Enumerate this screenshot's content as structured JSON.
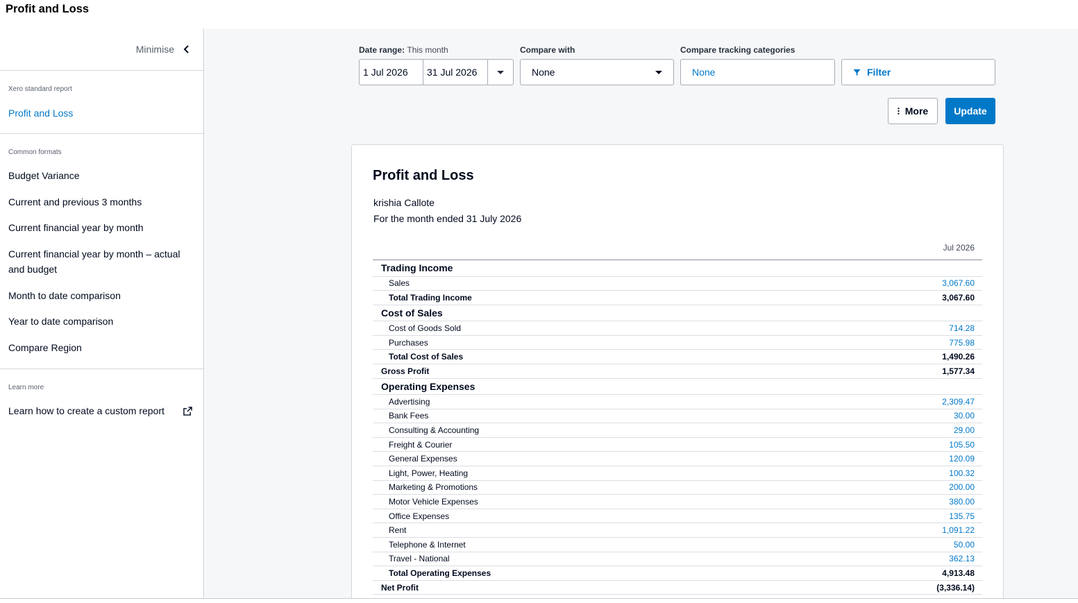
{
  "page_title": "Profit and Loss",
  "sidebar": {
    "minimise_label": "Minimise",
    "standard_heading": "Xero standard report",
    "standard_link": "Profit and Loss",
    "common_heading": "Common formats",
    "formats": [
      "Budget Variance",
      "Current and previous 3 months",
      "Current financial year by month",
      "Current financial year by month – actual and budget",
      "Month to date comparison",
      "Year to date comparison",
      "Compare Region"
    ],
    "learn_heading": "Learn more",
    "learn_link": "Learn how to create a custom report"
  },
  "controls": {
    "date_range_label": "Date range:",
    "date_range_value": "This month",
    "date_from": "1 Jul 2026",
    "date_to": "31 Jul 2026",
    "compare_with_label": "Compare with",
    "compare_with_value": "None",
    "tracking_label": "Compare tracking categories",
    "tracking_value": "None",
    "filter_label": "Filter",
    "more_label": "More",
    "update_label": "Update"
  },
  "report": {
    "title": "Profit and Loss",
    "organisation": "krishia Callote",
    "period": "For the month ended 31 July 2026",
    "column_header": "Jul 2026",
    "rows": [
      {
        "type": "section",
        "label": "Trading Income"
      },
      {
        "type": "line",
        "label": "Sales",
        "amount": "3,067.60"
      },
      {
        "type": "total",
        "label": "Total Trading Income",
        "amount": "3,067.60"
      },
      {
        "type": "section",
        "label": "Cost of Sales"
      },
      {
        "type": "line",
        "label": "Cost of Goods Sold",
        "amount": "714.28"
      },
      {
        "type": "line",
        "label": "Purchases",
        "amount": "775.98"
      },
      {
        "type": "total",
        "label": "Total Cost of Sales",
        "amount": "1,490.26"
      },
      {
        "type": "grand",
        "label": "Gross Profit",
        "amount": "1,577.34"
      },
      {
        "type": "section",
        "label": "Operating Expenses"
      },
      {
        "type": "line",
        "label": "Advertising",
        "amount": "2,309.47"
      },
      {
        "type": "line",
        "label": "Bank Fees",
        "amount": "30.00"
      },
      {
        "type": "line",
        "label": "Consulting & Accounting",
        "amount": "29.00"
      },
      {
        "type": "line",
        "label": "Freight & Courier",
        "amount": "105.50"
      },
      {
        "type": "line",
        "label": "General Expenses",
        "amount": "120.09"
      },
      {
        "type": "line",
        "label": "Light, Power, Heating",
        "amount": "100.32"
      },
      {
        "type": "line",
        "label": "Marketing & Promotions",
        "amount": "200.00"
      },
      {
        "type": "line",
        "label": "Motor Vehicle Expenses",
        "amount": "380.00"
      },
      {
        "type": "line",
        "label": "Office Expenses",
        "amount": "135.75"
      },
      {
        "type": "line",
        "label": "Rent",
        "amount": "1,091.22"
      },
      {
        "type": "line",
        "label": "Telephone & Internet",
        "amount": "50.00"
      },
      {
        "type": "line",
        "label": "Travel - National",
        "amount": "362.13"
      },
      {
        "type": "total",
        "label": "Total Operating Expenses",
        "amount": "4,913.48"
      },
      {
        "type": "grand",
        "label": "Net Profit",
        "amount": "(3,336.14)"
      }
    ]
  },
  "colors": {
    "accent": "#0078c8",
    "text": "#000a1e",
    "muted": "#59606d",
    "panel_bg": "#f6f7f8"
  },
  "icons": {
    "minimise": "chevron-left-icon",
    "dropdown": "caret-down-icon",
    "filter": "funnel-icon",
    "more": "vertical-ellipsis-icon",
    "external": "external-link-icon"
  }
}
